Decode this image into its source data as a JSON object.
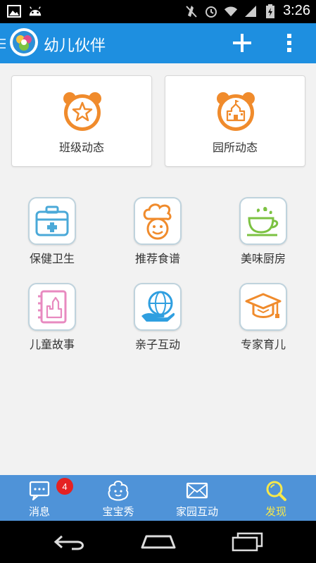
{
  "status_bar": {
    "time": "3:26",
    "icons": [
      "image-notification-icon",
      "android-icon",
      "mute-icon",
      "alarm-icon",
      "wifi-icon",
      "signal-icon",
      "battery-icon"
    ]
  },
  "app_bar": {
    "title": "幼儿伙伴",
    "logo_icon": "app-logo-icon",
    "add_icon": "plus-icon",
    "more_icon": "overflow-menu-icon"
  },
  "cards": [
    {
      "label": "班级动态",
      "icon": "star-clock-icon"
    },
    {
      "label": "园所动态",
      "icon": "school-clock-icon"
    }
  ],
  "tiles": [
    {
      "label": "保健卫生",
      "icon": "first-aid-kit-icon"
    },
    {
      "label": "推荐食谱",
      "icon": "chef-icon"
    },
    {
      "label": "美味厨房",
      "icon": "teacup-icon"
    },
    {
      "label": "儿童故事",
      "icon": "castle-book-icon"
    },
    {
      "label": "亲子互动",
      "icon": "globe-hand-icon"
    },
    {
      "label": "专家育儿",
      "icon": "graduation-cap-icon"
    }
  ],
  "tab_bar": {
    "tabs": [
      {
        "label": "消息",
        "icon": "message-icon",
        "badge": "4"
      },
      {
        "label": "宝宝秀",
        "icon": "baby-face-icon"
      },
      {
        "label": "家园互动",
        "icon": "mail-icon"
      },
      {
        "label": "发现",
        "icon": "discover-search-icon",
        "active": true
      }
    ]
  },
  "colors": {
    "app_bar": "#1e8fe0",
    "tab_bar": "#4f93d8",
    "active_tab": "#f7e84a",
    "accent_orange": "#f08b2c",
    "badge": "#e52222"
  }
}
